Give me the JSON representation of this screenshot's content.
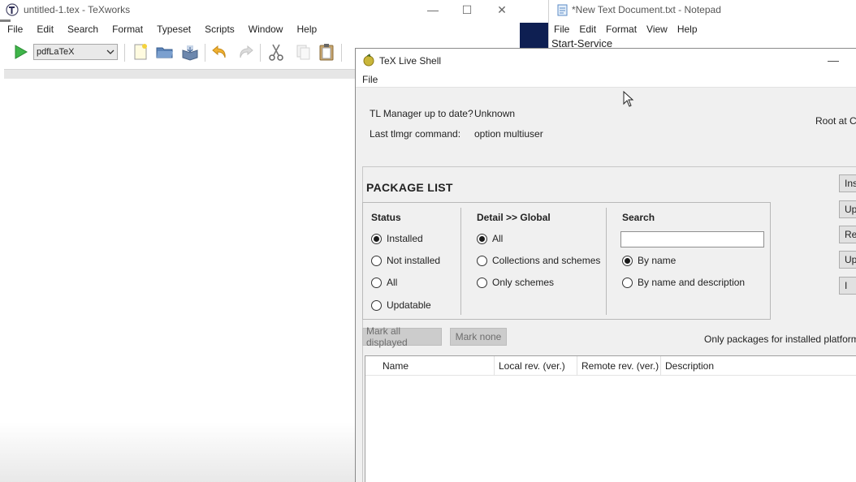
{
  "texworks": {
    "title": "untitled-1.tex - TeXworks",
    "menu": [
      "File",
      "Edit",
      "Search",
      "Format",
      "Typeset",
      "Scripts",
      "Window",
      "Help"
    ],
    "engine": "pdfLaTeX",
    "window_controls": {
      "minimize": "—",
      "maximize": "☐",
      "close": "✕"
    },
    "icons": [
      "typeset-play-icon",
      "new-file-icon",
      "open-folder-icon",
      "save-icon",
      "undo-icon",
      "redo-icon",
      "cut-icon",
      "copy-icon",
      "paste-icon"
    ]
  },
  "notepad": {
    "title": "*New Text Document.txt - Notepad",
    "menu": [
      "File",
      "Edit",
      "Format",
      "View",
      "Help"
    ],
    "content": "Start-Service"
  },
  "tlshell": {
    "title": "TeX Live Shell",
    "menu": [
      "File"
    ],
    "minimize": "—",
    "info": {
      "uptodate_label": "TL Manager up to date?",
      "uptodate_value": "Unknown",
      "lastcmd_label": "Last tlmgr command:",
      "lastcmd_value": "option multiuser",
      "root": "Root at C:/"
    },
    "package_list_title": "PACKAGE LIST",
    "status": {
      "heading": "Status",
      "options": [
        "Installed",
        "Not installed",
        "All",
        "Updatable"
      ],
      "selected": "Installed"
    },
    "detail": {
      "heading": "Detail >> Global",
      "options": [
        "All",
        "Collections and schemes",
        "Only schemes"
      ],
      "selected": "All"
    },
    "search": {
      "heading": "Search",
      "value": "",
      "options": [
        "By name",
        "By name and description"
      ],
      "selected": "By name"
    },
    "side_buttons": [
      "Ins",
      "Upd",
      "Rem",
      "Up",
      "I"
    ],
    "mark_all": "Mark all displayed",
    "mark_none": "Mark none",
    "only_installed": "Only packages for installed platforms",
    "table_columns": [
      "Name",
      "Local rev. (ver.)",
      "Remote rev. (ver.)",
      "Description"
    ]
  }
}
